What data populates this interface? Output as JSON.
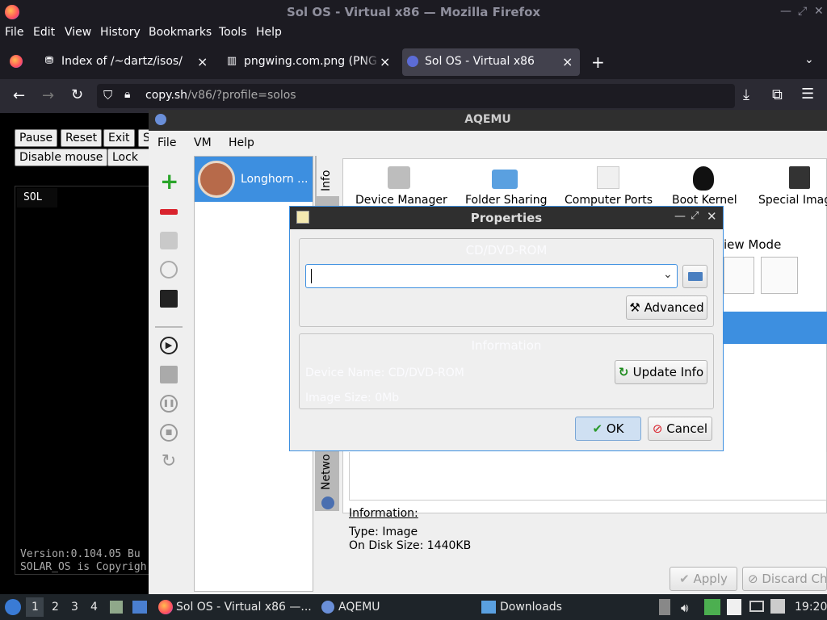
{
  "window": {
    "title": "Sol OS - Virtual x86 — Mozilla Firefox"
  },
  "menubar": [
    "File",
    "Edit",
    "View",
    "History",
    "Bookmarks",
    "Tools",
    "Help"
  ],
  "tabs": [
    {
      "label": "Index of /~dartz/isos/",
      "icon": "tab-page-icon"
    },
    {
      "label": "pngwing.com.png (PNG I",
      "icon": "tab-image-icon"
    },
    {
      "label": "Sol OS - Virtual x86",
      "icon": "tab-v86-icon",
      "active": true
    }
  ],
  "url": {
    "domain": "copy.sh",
    "path": "/v86/?profile=solos"
  },
  "v86": {
    "buttons": [
      "Pause",
      "Reset",
      "Exit",
      "S",
      "Disable mouse",
      "Lock m"
    ],
    "screen_top": "SOL",
    "screen_bottom": [
      "Version:0.104.05  Bu",
      "SOLAR_OS is Copyrigh"
    ]
  },
  "aqemu": {
    "title": "AQEMU",
    "menu": [
      "File",
      "VM",
      "Help"
    ],
    "vm_name": "Longhorn ...",
    "vtabs": [
      "Info",
      "Netwo"
    ],
    "icons": [
      "Device Manager",
      "Folder Sharing",
      "Computer Ports",
      "Boot Kernel",
      "Special Imag"
    ],
    "view_mode": "iew Mode",
    "info_label": "Information:",
    "info_lines": [
      "Type: Image",
      "On Disk Size: 1440KB"
    ],
    "apply": "Apply",
    "discard": "Discard Cha"
  },
  "dialog": {
    "title": "Properties",
    "cdrom_group": "CD/DVD-ROM",
    "path_value": "",
    "advanced": "Advanced",
    "info_group": "Information",
    "device_name": "Device Name: CD/DVD-ROM",
    "image_size": "Image Size: 0Mb",
    "update_info": "Update Info",
    "ok": "OK",
    "cancel": "Cancel"
  },
  "taskbar": {
    "workspaces": [
      "1",
      "2",
      "3",
      "4"
    ],
    "apps": [
      "Sol OS - Virtual x86 —...",
      "AQEMU",
      "Downloads"
    ],
    "clock": "19:20"
  },
  "colors": {
    "accent": "#3d8fe0",
    "chrome_dark": "#1c1b22",
    "ok_bg": "#cfe0f2"
  }
}
